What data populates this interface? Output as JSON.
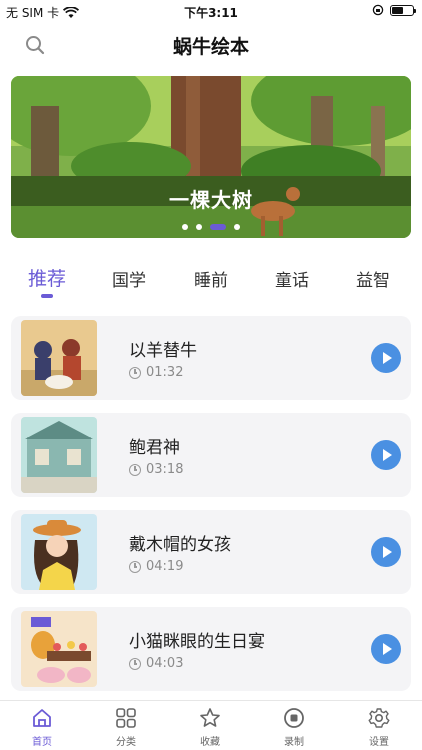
{
  "status_bar": {
    "carrier": "无 SIM 卡",
    "time": "下午3:11",
    "battery_level": 0.55
  },
  "header": {
    "title": "蜗牛绘本",
    "search_icon": "search-icon"
  },
  "banner": {
    "caption": "一棵大树",
    "page_count": 4,
    "active_page": 3
  },
  "tabs": [
    {
      "label": "推荐",
      "active": true
    },
    {
      "label": "国学",
      "active": false
    },
    {
      "label": "睡前",
      "active": false
    },
    {
      "label": "童话",
      "active": false
    },
    {
      "label": "益智",
      "active": false
    }
  ],
  "stories": [
    {
      "title": "以羊替牛",
      "duration": "01:32"
    },
    {
      "title": "鲍君神",
      "duration": "03:18"
    },
    {
      "title": "戴木帽的女孩",
      "duration": "04:19"
    },
    {
      "title": "小猫眯眼的生日宴",
      "duration": "04:03"
    }
  ],
  "nav": [
    {
      "label": "首页",
      "icon": "home-icon",
      "active": true
    },
    {
      "label": "分类",
      "icon": "grid-icon",
      "active": false
    },
    {
      "label": "收藏",
      "icon": "star-icon",
      "active": false
    },
    {
      "label": "录制",
      "icon": "record-icon",
      "active": false
    },
    {
      "label": "设置",
      "icon": "gear-icon",
      "active": false
    }
  ],
  "colors": {
    "accent": "#6b5bd6",
    "play": "#4a90e2",
    "card": "#f4f4f6"
  }
}
